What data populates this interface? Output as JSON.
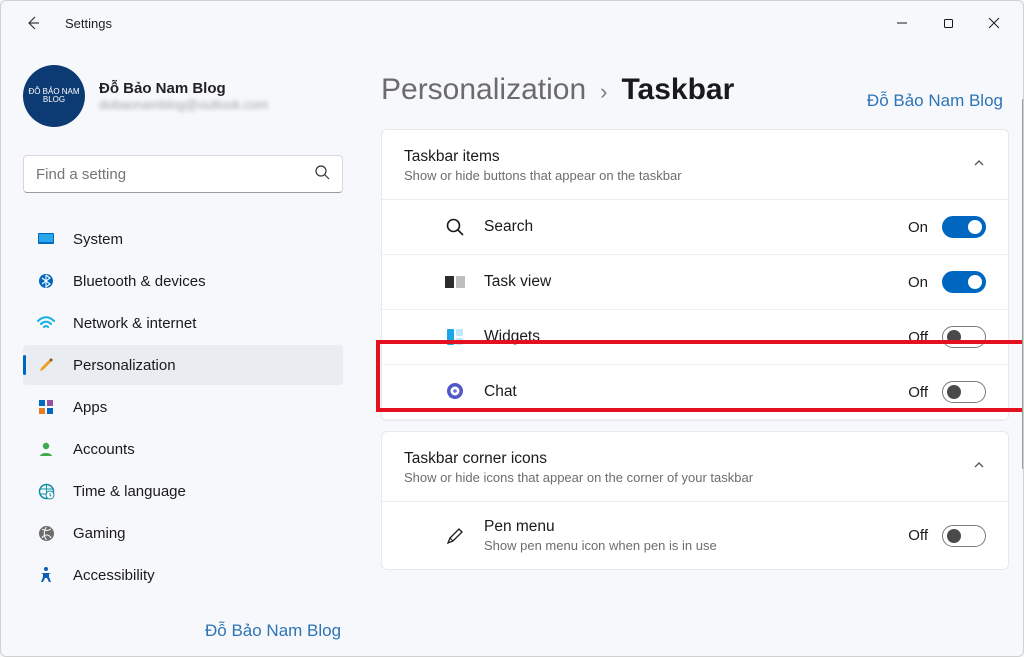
{
  "app": {
    "title": "Settings"
  },
  "profile": {
    "name": "Đỗ Bảo Nam Blog",
    "email": "dobaonamblog@outlook.com",
    "avatar_text": "ĐỖ BẢO NAM BLOG"
  },
  "search": {
    "placeholder": "Find a setting"
  },
  "sidebar": {
    "items": [
      {
        "id": "system",
        "label": "System"
      },
      {
        "id": "bluetooth",
        "label": "Bluetooth & devices"
      },
      {
        "id": "network",
        "label": "Network & internet"
      },
      {
        "id": "personalization",
        "label": "Personalization",
        "selected": true
      },
      {
        "id": "apps",
        "label": "Apps"
      },
      {
        "id": "accounts",
        "label": "Accounts"
      },
      {
        "id": "time",
        "label": "Time & language"
      },
      {
        "id": "gaming",
        "label": "Gaming"
      },
      {
        "id": "accessibility",
        "label": "Accessibility"
      }
    ]
  },
  "breadcrumb": {
    "parent": "Personalization",
    "current": "Taskbar"
  },
  "sections": {
    "taskbar_items": {
      "title": "Taskbar items",
      "subtitle": "Show or hide buttons that appear on the taskbar",
      "rows": [
        {
          "id": "search",
          "label": "Search",
          "state": "On"
        },
        {
          "id": "taskview",
          "label": "Task view",
          "state": "On"
        },
        {
          "id": "widgets",
          "label": "Widgets",
          "state": "Off"
        },
        {
          "id": "chat",
          "label": "Chat",
          "state": "Off"
        }
      ]
    },
    "corner_icons": {
      "title": "Taskbar corner icons",
      "subtitle": "Show or hide icons that appear on the corner of your taskbar",
      "rows": [
        {
          "id": "penmenu",
          "label": "Pen menu",
          "sub": "Show pen menu icon when pen is in use",
          "state": "Off"
        }
      ]
    }
  },
  "watermark": "Đỗ Bảo Nam Blog"
}
